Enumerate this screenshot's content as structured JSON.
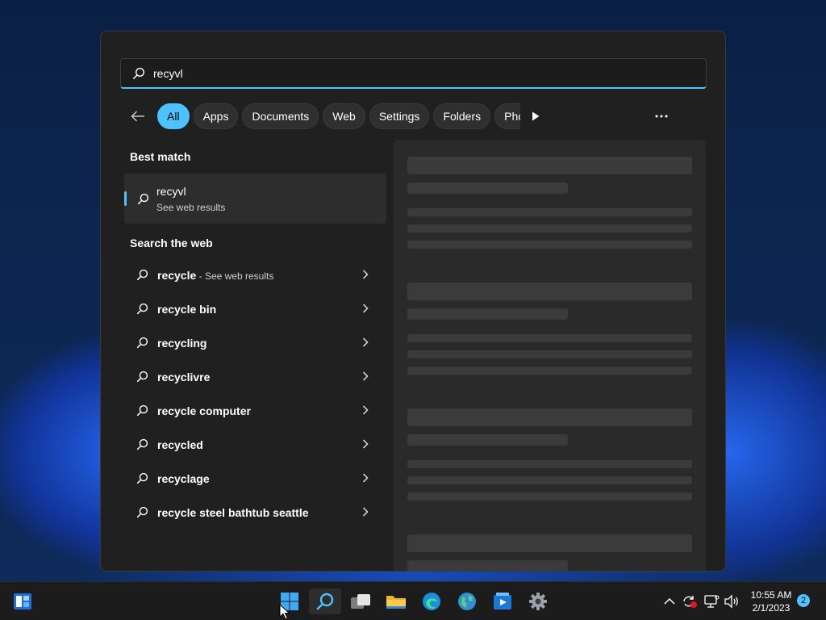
{
  "search": {
    "query": "recyvl",
    "placeholder": ""
  },
  "filters": [
    "All",
    "Apps",
    "Documents",
    "Web",
    "Settings",
    "Folders",
    "Phot"
  ],
  "best_match": {
    "heading": "Best match",
    "title": "recyvl",
    "subtitle": "See web results"
  },
  "web": {
    "heading": "Search the web",
    "items": [
      {
        "text": "recycle",
        "suffix": " - See web results"
      },
      {
        "text": "recycle bin",
        "suffix": ""
      },
      {
        "text": "recycling",
        "suffix": ""
      },
      {
        "text": "recyclivre",
        "suffix": ""
      },
      {
        "text": "recycle computer",
        "suffix": ""
      },
      {
        "text": "recycled",
        "suffix": ""
      },
      {
        "text": "recyclage",
        "suffix": ""
      },
      {
        "text": "recycle steel bathtub seattle",
        "suffix": ""
      }
    ]
  },
  "taskbar": {
    "icons": [
      "widgets-icon",
      "start-icon",
      "search-icon",
      "task-view-icon",
      "file-explorer-icon",
      "edge-icon",
      "maps-icon",
      "photos-icon",
      "settings-icon"
    ]
  },
  "clock": {
    "time": "10:55 AM",
    "date": "2/1/2023"
  },
  "notifications": {
    "count": "2"
  },
  "colors": {
    "accent": "#4cc2ff",
    "panel": "#202020",
    "taskbar": "#1c1c1c"
  }
}
